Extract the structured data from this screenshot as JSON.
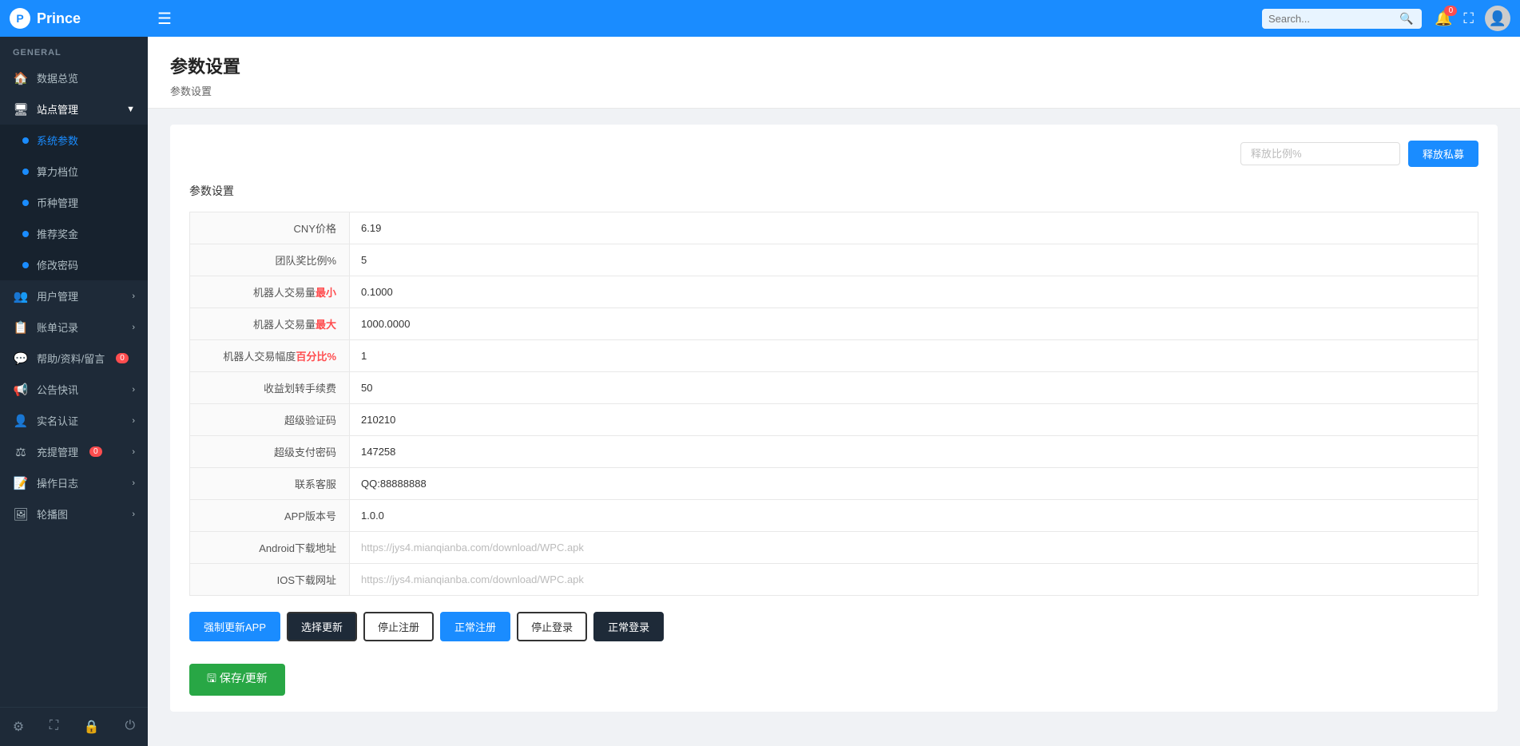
{
  "app": {
    "name": "Prince",
    "logo_initial": "P"
  },
  "topnav": {
    "hamburger_icon": "☰",
    "search_placeholder": "Search...",
    "bell_badge": "0",
    "expand_icon": "⛶",
    "avatar_icon": "👤"
  },
  "sidebar": {
    "section_label": "GENERAL",
    "items": [
      {
        "id": "dashboard",
        "icon": "🏠",
        "label": "数据总览",
        "has_sub": false
      },
      {
        "id": "station",
        "icon": "🖥",
        "label": "站点管理",
        "has_sub": true,
        "expanded": true
      },
      {
        "id": "sysparams",
        "icon": "",
        "label": "系统参数",
        "is_sub": true,
        "active": true
      },
      {
        "id": "compute",
        "icon": "",
        "label": "算力档位",
        "is_sub": true
      },
      {
        "id": "currency",
        "icon": "",
        "label": "币种管理",
        "is_sub": true
      },
      {
        "id": "referral",
        "icon": "",
        "label": "推荐奖金",
        "is_sub": true
      },
      {
        "id": "changepwd",
        "icon": "",
        "label": "修改密码",
        "is_sub": true
      },
      {
        "id": "usermgr",
        "icon": "👥",
        "label": "用户管理",
        "has_arrow": true
      },
      {
        "id": "billrecord",
        "icon": "📋",
        "label": "账单记录",
        "has_arrow": true
      },
      {
        "id": "helpfeedback",
        "icon": "💬",
        "label": "帮助/资料/留言",
        "badge": "0"
      },
      {
        "id": "announcement",
        "icon": "📢",
        "label": "公告快讯",
        "has_arrow": true
      },
      {
        "id": "realname",
        "icon": "👤",
        "label": "实名认证",
        "has_arrow": true
      },
      {
        "id": "recharge",
        "icon": "⚖",
        "label": "充提管理",
        "badge": "0",
        "has_arrow": true
      },
      {
        "id": "oplog",
        "icon": "📝",
        "label": "操作日志",
        "has_arrow": true
      },
      {
        "id": "banner",
        "icon": "🖼",
        "label": "轮播图",
        "has_arrow": true
      }
    ],
    "bottom_icons": [
      "⚙",
      "⛶",
      "🔒",
      "⏻"
    ]
  },
  "page": {
    "title": "参数设置",
    "breadcrumb": "参数设置"
  },
  "release_section": {
    "input_placeholder": "释放比例%",
    "button_label": "释放私募"
  },
  "params_section": {
    "label": "参数设置",
    "fields": [
      {
        "id": "cny_price",
        "label": "CNY价格",
        "value": "6.19",
        "label_suffix": ""
      },
      {
        "id": "team_reward",
        "label": "团队奖比例%",
        "value": "5",
        "label_suffix": ""
      },
      {
        "id": "robot_min",
        "label": "机器人交易量",
        "label_red": "最小",
        "value": "0.1000"
      },
      {
        "id": "robot_max",
        "label": "机器人交易量",
        "label_red": "最大",
        "value": "1000.0000"
      },
      {
        "id": "robot_range",
        "label": "机器人交易幅度",
        "label_red": "百分比%",
        "value": "1"
      },
      {
        "id": "withdraw_fee",
        "label": "收益划转手续费",
        "value": "50",
        "label_suffix": ""
      },
      {
        "id": "super_verify",
        "label": "超级验证码",
        "value": "210210",
        "label_suffix": ""
      },
      {
        "id": "super_pay",
        "label": "超级支付密码",
        "value": "147258",
        "label_suffix": ""
      },
      {
        "id": "customer_service",
        "label": "联系客服",
        "value": "QQ:88888888",
        "label_suffix": ""
      },
      {
        "id": "app_version",
        "label": "APP版本号",
        "value": "1.0.0",
        "label_suffix": ""
      },
      {
        "id": "android_url",
        "label": "Android下载地址",
        "value": "https://jys4.mianqianba.com/download/WPC.apk",
        "placeholder": true
      },
      {
        "id": "ios_url",
        "label": "IOS下载网址",
        "value": "https://jys4.mianqianba.com/download/WPC.apk",
        "placeholder": true
      }
    ]
  },
  "action_buttons": [
    {
      "id": "force_update",
      "label": "强制更新APP",
      "style": "primary"
    },
    {
      "id": "choose_update",
      "label": "选择更新",
      "style": "outline-dark"
    },
    {
      "id": "stop_register",
      "label": "停止注册",
      "style": "outline-dark"
    },
    {
      "id": "normal_register",
      "label": "正常注册",
      "style": "outline-dark"
    },
    {
      "id": "stop_login",
      "label": "停止登录",
      "style": "outline-dark"
    },
    {
      "id": "normal_login",
      "label": "正常登录",
      "style": "outline-dark-selected"
    }
  ],
  "save_button": {
    "label": "🖫 保存/更新"
  }
}
